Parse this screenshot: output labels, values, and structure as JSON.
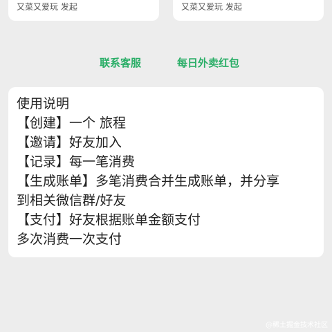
{
  "trip_cards": [
    {
      "creator_line": "又菜又爱玩 发起"
    },
    {
      "creator_line": "又菜又爱玩 发起"
    }
  ],
  "links": {
    "customer_service": "联系客服",
    "daily_coupon": "每日外卖红包"
  },
  "instructions": {
    "title": "使用说明",
    "lines": [
      "【创建】一个 旅程",
      "【邀请】好友加入",
      "【记录】每一笔消费",
      "【生成账单】多笔消费合并生成账单，并分享",
      "到相关微信群/好友",
      "【支付】好友根据账单金额支付",
      "多次消费一次支付"
    ]
  },
  "watermark": "@稀土掘金技术社区",
  "colors": {
    "background": "#ededed",
    "card": "#ffffff",
    "accent_green": "#2aae67",
    "text": "#222222"
  }
}
